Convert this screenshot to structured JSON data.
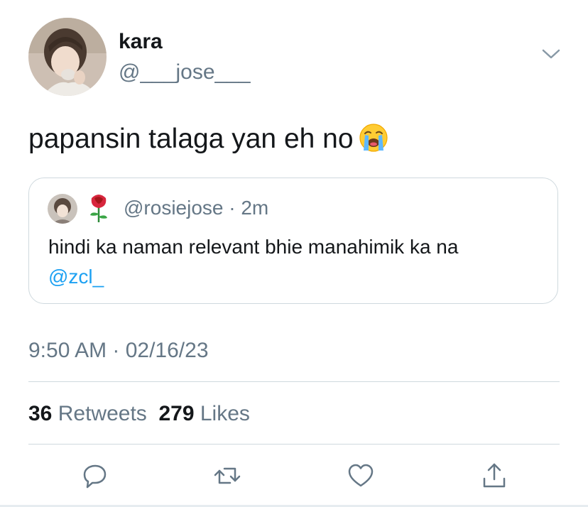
{
  "tweet": {
    "author": {
      "display_name": "kara",
      "handle": "@___jose___"
    },
    "text": "papansin talaga yan eh no",
    "emoji": "loudly-crying-face",
    "quoted": {
      "handle_line": "@rosiejose · 2m",
      "text": "hindi ka naman relevant bhie manahimik ka na",
      "mention": "@zcl_"
    },
    "timestamp": "9:50 AM · 02/16/23",
    "stats": {
      "retweets_count": "36",
      "retweets_label": "Retweets",
      "likes_count": "279",
      "likes_label": "Likes"
    },
    "actions": [
      {
        "icon": "reply-icon"
      },
      {
        "icon": "retweet-icon"
      },
      {
        "icon": "like-icon"
      },
      {
        "icon": "share-icon"
      }
    ]
  },
  "colors": {
    "text_primary": "#14171a",
    "text_secondary": "#657786",
    "link": "#1da1f2",
    "border": "#cfd9de"
  }
}
